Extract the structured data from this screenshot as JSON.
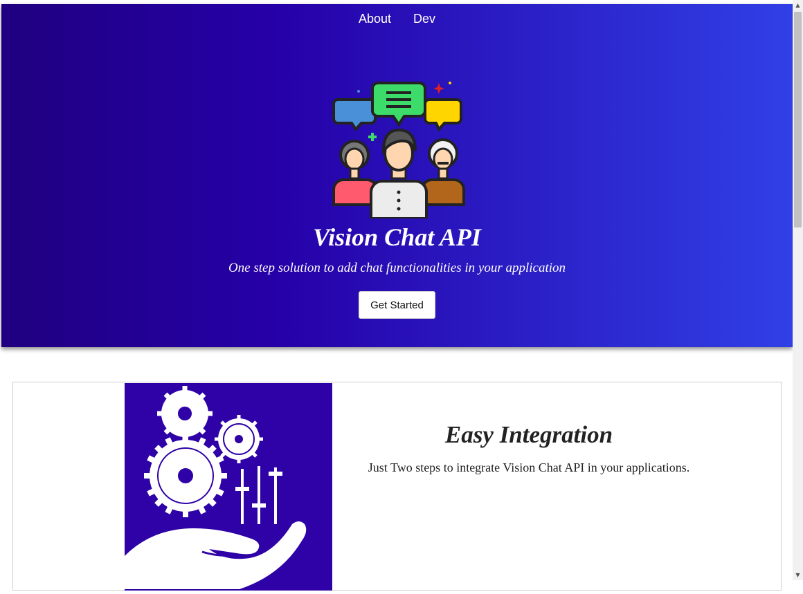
{
  "nav": {
    "links": [
      {
        "label": "About"
      },
      {
        "label": "Dev"
      }
    ]
  },
  "hero": {
    "title": "Vision Chat API",
    "subtitle": "One step solution to add chat functionalities in your application",
    "cta_label": "Get Started",
    "illustration_icon": "people-chat-bubbles-icon"
  },
  "feature": {
    "title": "Easy Integration",
    "description": "Just Two steps to integrate Vision Chat API in your applications.",
    "image_icon": "gears-hand-icon"
  },
  "colors": {
    "hero_gradient_start": "#200080",
    "hero_gradient_end": "#3040e6",
    "feature_image_bg": "#2e02a6"
  }
}
